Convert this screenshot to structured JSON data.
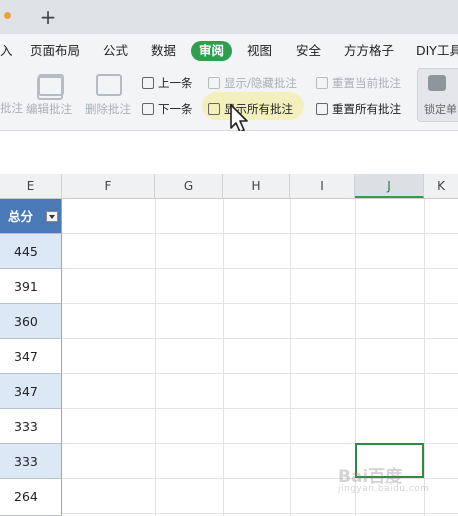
{
  "tabstrip": {
    "new_tab_label": "+"
  },
  "menu": {
    "items": [
      {
        "label": "入",
        "active": false
      },
      {
        "label": "页面布局",
        "active": false
      },
      {
        "label": "公式",
        "active": false
      },
      {
        "label": "数据",
        "active": false
      },
      {
        "label": "审阅",
        "active": true
      },
      {
        "label": "视图",
        "active": false
      },
      {
        "label": "安全",
        "active": false
      },
      {
        "label": "方方格子",
        "active": false
      },
      {
        "label": "DIY工具",
        "active": false
      }
    ]
  },
  "ribbon": {
    "partial_left_label": "批注",
    "edit_comment": "编辑批注",
    "delete_comment": "删除批注",
    "prev": "上一条",
    "next": "下一条",
    "show_hide_comment": "显示/隐藏批注",
    "show_all_comments": "显示所有批注",
    "reset_current_comment": "重置当前批注",
    "reset_all_comments": "重置所有批注",
    "lock_cell": "锁定单"
  },
  "columns": [
    "E",
    "F",
    "G",
    "H",
    "I",
    "J",
    "K"
  ],
  "selected_column": "J",
  "column_e": {
    "header": "总分",
    "values": [
      "445",
      "391",
      "360",
      "347",
      "347",
      "333",
      "333",
      "264"
    ]
  },
  "watermark": {
    "main": "Bai百度",
    "sub": "jingyan.baidu.com"
  },
  "colors": {
    "accent": "#2e9f4d",
    "header_blue": "#4a79b8",
    "row_blue": "#dde8f7"
  }
}
